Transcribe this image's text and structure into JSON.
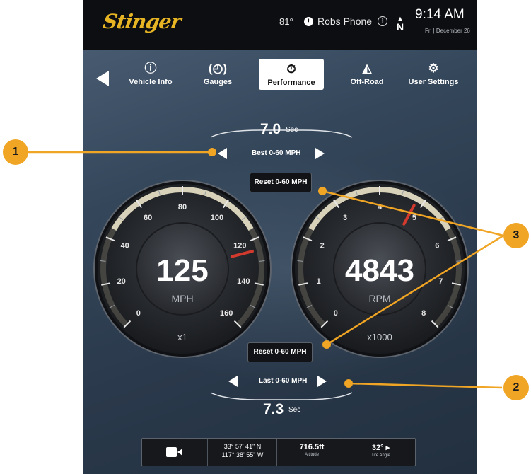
{
  "status_bar": {
    "logo": "Stinger",
    "temperature": "81°",
    "phone_name": "Robs Phone",
    "compass": "N",
    "time": "9:14 AM",
    "date": "Fri | December 26"
  },
  "nav": {
    "items": [
      {
        "label": "Vehicle Info",
        "icon": "info-icon"
      },
      {
        "label": "Gauges",
        "icon": "gauges-icon"
      },
      {
        "label": "Performance",
        "icon": "stopwatch-icon",
        "active": true
      },
      {
        "label": "Off-Road",
        "icon": "mountain-icon"
      },
      {
        "label": "User Settings",
        "icon": "gear-icon"
      }
    ]
  },
  "best": {
    "time": "7.0",
    "unit": "Sec",
    "label": "Best 0-60 MPH"
  },
  "last": {
    "time": "7.3",
    "unit": "Sec",
    "label": "Last 0-60 MPH"
  },
  "reset_top": "Reset 0-60 MPH",
  "reset_bottom": "Reset 0-60 MPH",
  "speed_gauge": {
    "value": "125",
    "unit": "MPH",
    "multiplier": "x1",
    "ticks": [
      "0",
      "20",
      "40",
      "60",
      "80",
      "100",
      "120",
      "140",
      "160"
    ],
    "needle_value": 125,
    "min": 0,
    "max": 160
  },
  "rpm_gauge": {
    "value": "4843",
    "unit": "RPM",
    "multiplier": "x1000",
    "ticks": [
      "0",
      "1",
      "2",
      "3",
      "4",
      "5",
      "6",
      "7",
      "8"
    ],
    "needle_value": 4.843,
    "min": 0,
    "max": 8,
    "redline": "5"
  },
  "bottom_bar": {
    "camera_icon": "camera-icon",
    "lat": "33° 57' 41\" N",
    "lon": "117° 38' 55\" W",
    "altitude_value": "716.5ft",
    "altitude_label": "Altitude",
    "tire_angle_value": "32° ▸",
    "tire_angle_label": "Tire Angle"
  },
  "callouts": [
    "1",
    "2",
    "3"
  ],
  "colors": {
    "accent": "#f0a524",
    "needle": "#d23a2e",
    "logo": "#e7b523"
  }
}
